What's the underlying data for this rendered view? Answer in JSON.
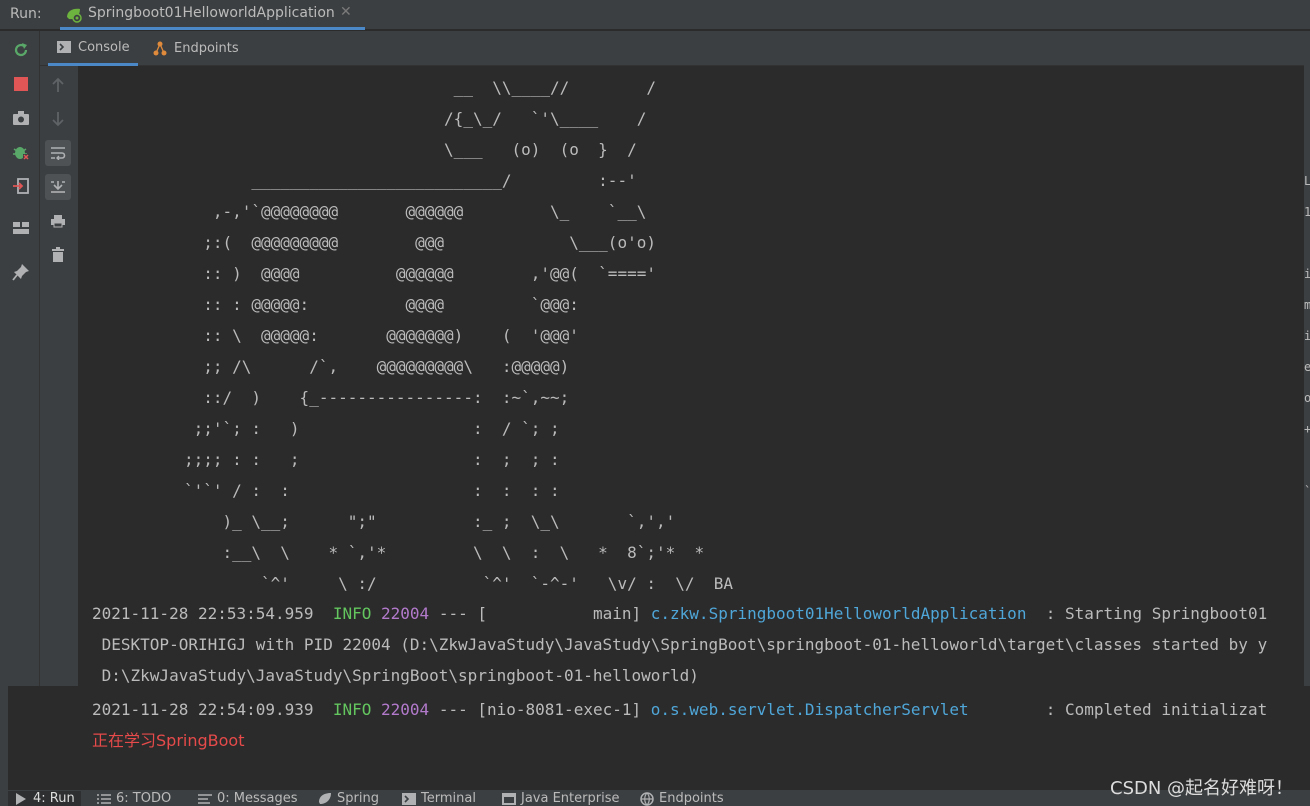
{
  "run_header": {
    "label": "Run:",
    "tab_title": "Springboot01HelloworldApplication",
    "close_glyph": "✕"
  },
  "sub_tabs": [
    {
      "label": "Console",
      "icon": "console-icon"
    },
    {
      "label": "Endpoints",
      "icon": "endpoints-icon"
    }
  ],
  "banner_lines": [
    "                                       __  \\\\____//        /",
    "                                      /{_\\_/   `'\\____    /",
    "                                      \\___   (o)  (o  }  /",
    "                  __________________________/         :--'",
    "              ,-,'`@@@@@@@@       @@@@@@         \\_    `__\\",
    "             ;:(  @@@@@@@@@        @@@             \\___(o'o)",
    "             :: )  @@@@          @@@@@@        ,'@@(  `===='",
    "             :: : @@@@@:          @@@@         `@@@:",
    "             :: \\  @@@@@:       @@@@@@@)    (  '@@@'",
    "             ;; /\\      /`,    @@@@@@@@@\\   :@@@@@)",
    "             ::/  )    {_----------------:  :~`,~~;",
    "            ;;'`; :   )                  :  / `; ;",
    "           ;;;; : :   ;                  :  ;  ; :",
    "           `'`' / :  :                   :  :  : :",
    "               )_ \\__;      \";\"          :_ ;  \\_\\       `,','",
    "               :__\\  \\    * `,'*         \\  \\  :  \\   *  8`;'*  *",
    "                   `^'     \\ :/           `^'  `-^-'   \\v/ :  \\/  BA"
  ],
  "log_1": {
    "timestamp": "2021-11-28 22:53:54.959",
    "level": "INFO",
    "pid": "22004",
    "sep": "---",
    "thread": "[           main]",
    "logger": "c.zkw.Springboot01HelloworldApplication",
    "message": " : Starting Springboot01",
    "cont_1": " DESKTOP-ORIHIGJ with PID 22004 (D:\\ZkwJavaStudy\\JavaStudy\\SpringBoot\\springboot-01-helloworld\\target\\classes started by y",
    "cont_2": " D:\\ZkwJavaStudy\\JavaStudy\\SpringBoot\\springboot-01-helloworld)"
  },
  "log_2": {
    "timestamp": "2021-11-28 22:54:09.939",
    "level": "INFO",
    "pid": "22004",
    "sep": "---",
    "thread": "[nio-8081-exec-1]",
    "logger": "o.s.web.servlet.DispatcherServlet",
    "message": "       : Completed initializat"
  },
  "output_line": "正在学习SpringBoot",
  "right_edge_chars": [
    "L",
    "1",
    "",
    "i",
    "m",
    "i",
    "e",
    "o",
    "+",
    "",
    "`"
  ],
  "bottom_tabs": [
    {
      "label": "4: Run",
      "icon": "play-icon"
    },
    {
      "label": "6: TODO",
      "icon": "list-icon"
    },
    {
      "label": "0: Messages",
      "icon": "messages-icon"
    },
    {
      "label": "Spring",
      "icon": "spring-icon"
    },
    {
      "label": "Terminal",
      "icon": "terminal-icon"
    },
    {
      "label": "Java Enterprise",
      "icon": "java-enterprise-icon"
    },
    {
      "label": "Endpoints",
      "icon": "endpoints-icon"
    }
  ],
  "watermark": "CSDN @起名好难呀！",
  "colors": {
    "info": "#63c65e",
    "pid": "#b37acc",
    "logger": "#4fa6d8",
    "output": "#e64a4a",
    "accent": "#4a88c7"
  }
}
